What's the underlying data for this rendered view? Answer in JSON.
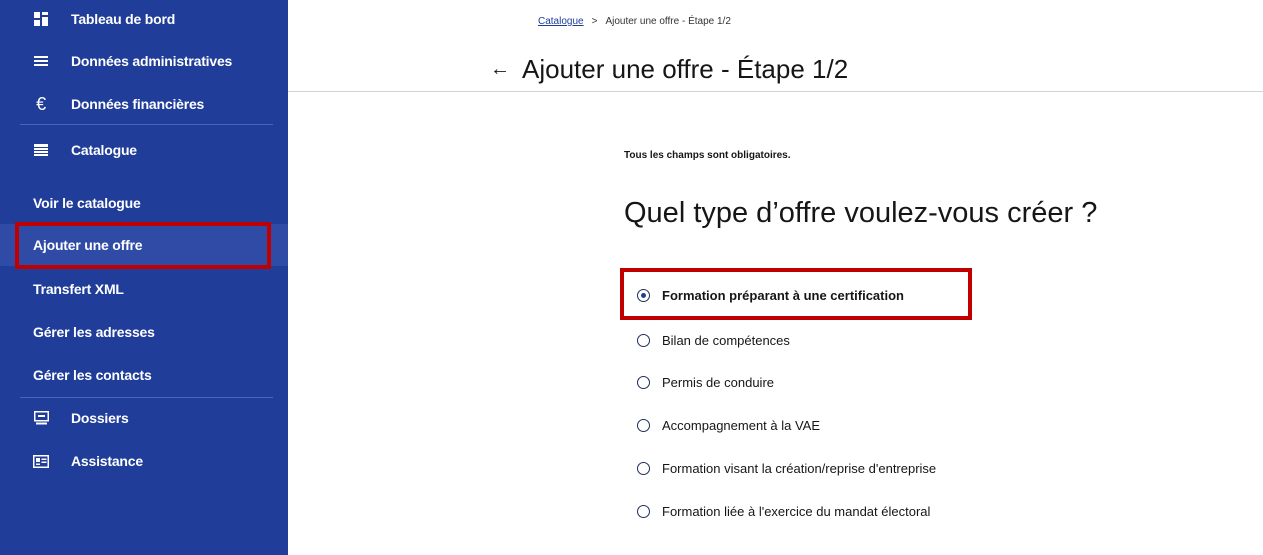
{
  "sidebar": {
    "items": [
      {
        "label": "Tableau de bord",
        "icon": "dashboard-icon"
      },
      {
        "label": "Données administratives",
        "icon": "list-icon"
      },
      {
        "label": "Données financières",
        "icon": "euro-icon"
      },
      {
        "label": "Catalogue",
        "icon": "catalog-icon"
      },
      {
        "label": "Voir le catalogue"
      },
      {
        "label": "Ajouter une offre"
      },
      {
        "label": "Transfert XML"
      },
      {
        "label": "Gérer les adresses"
      },
      {
        "label": "Gérer les contacts"
      },
      {
        "label": "Dossiers",
        "icon": "folder-icon"
      },
      {
        "label": "Assistance",
        "icon": "support-icon"
      }
    ]
  },
  "breadcrumb": {
    "link": "Catalogue",
    "separator": ">",
    "current": "Ajouter une offre - Étape 1/2"
  },
  "page": {
    "back_icon": "←",
    "title": "Ajouter une offre - Étape 1/2",
    "required_note": "Tous les champs sont obligatoires.",
    "question": "Quel type d’offre voulez-vous créer ?"
  },
  "options": [
    {
      "label": "Formation préparant à une certification",
      "selected": true
    },
    {
      "label": "Bilan de compétences",
      "selected": false
    },
    {
      "label": "Permis de conduire",
      "selected": false
    },
    {
      "label": "Accompagnement à la VAE",
      "selected": false
    },
    {
      "label": "Formation visant la création/reprise d'entreprise",
      "selected": false
    },
    {
      "label": "Formation liée à l'exercice du mandat électoral",
      "selected": false
    }
  ],
  "colors": {
    "sidebar": "#1f3d99",
    "highlight": "#c00000",
    "active": "#2f4ba6"
  }
}
